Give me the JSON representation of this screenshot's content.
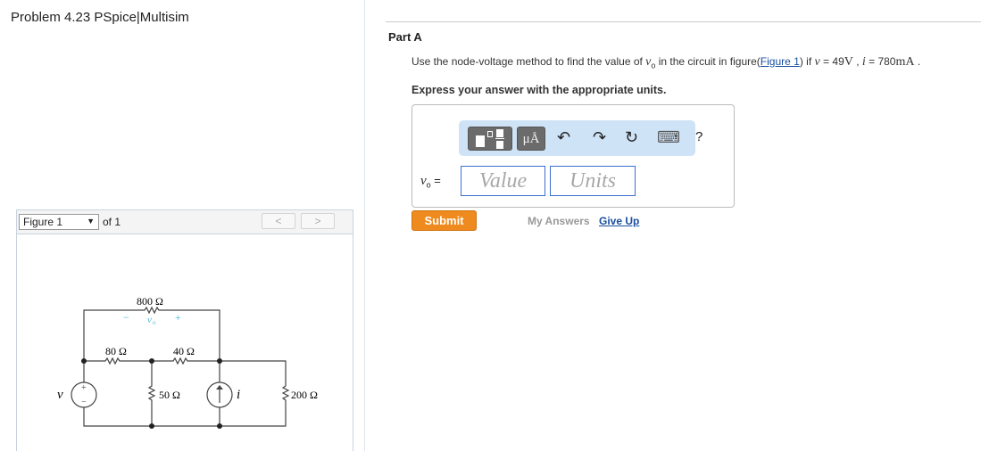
{
  "title": "Problem 4.23 PSpice|Multisim",
  "figure_panel": {
    "selected": "Figure 1",
    "of": "of 1",
    "prev": "<",
    "next": ">"
  },
  "circuit": {
    "r_top": "800 Ω",
    "r_left": "80 Ω",
    "r_mid": "40 Ω",
    "r_50": "50 Ω",
    "r_200": "200 Ω",
    "vsource": "v",
    "isource": "i",
    "vo_label": "v",
    "vo_sub": "o",
    "minus": "−",
    "plus": "+"
  },
  "part": {
    "label": "Part A",
    "q1": "Use the node-voltage method to find the value of ",
    "q_var": "v",
    "q_sub": "o",
    "q2": " in the circuit in figure(",
    "link": "Figure 1",
    "q3": ") if ",
    "v_var": "v",
    "v_eq": " = 49",
    "v_unit": "V",
    "sep": " , ",
    "i_var": "i",
    "i_eq": " = 780",
    "i_unit": "mA",
    "end": " .",
    "express": "Express your answer with the appropriate units."
  },
  "toolbar": {
    "units_btn": "μÅ",
    "undo": "↶",
    "redo": "↷",
    "reset": "↻",
    "keyboard": "⌨",
    "help": "?"
  },
  "answer": {
    "label_var": "v",
    "label_sub": "o",
    "eq": " =",
    "value_placeholder": "Value",
    "units_placeholder": "Units"
  },
  "actions": {
    "submit": "Submit",
    "my_answers": "My Answers",
    "give_up": "Give Up"
  }
}
